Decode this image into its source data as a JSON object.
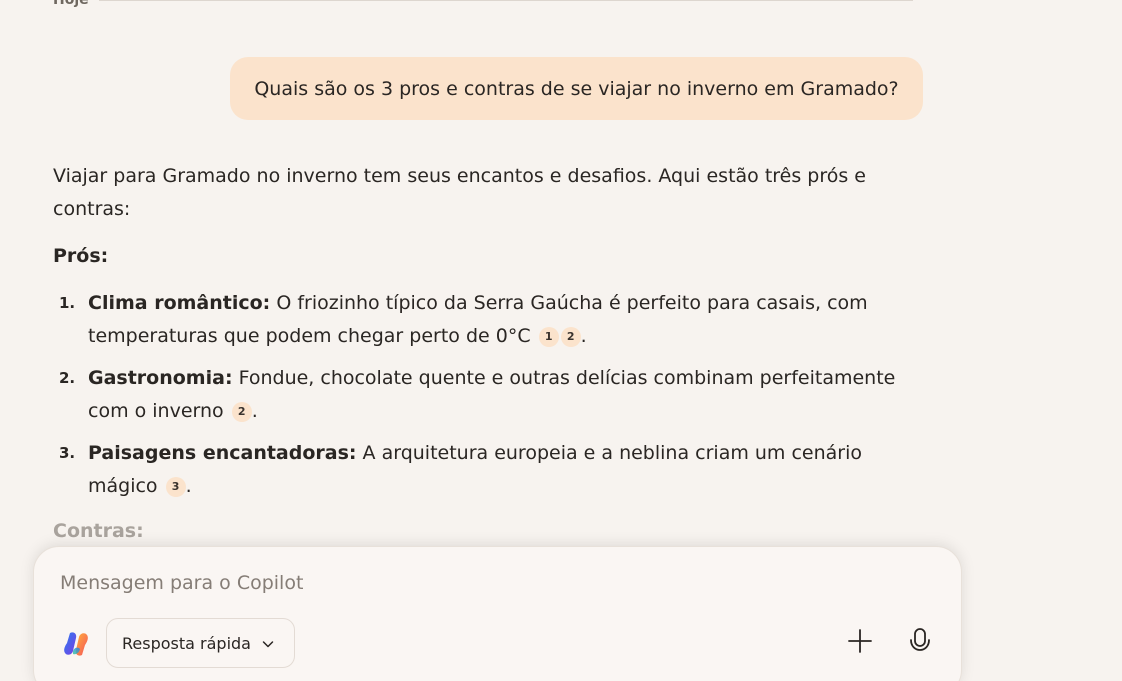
{
  "day_label": "Hoje",
  "user_message": "Quais são os 3 pros e contras de se viajar no inverno em Gramado?",
  "answer": {
    "intro": "Viajar para Gramado no inverno tem seus encantos e desafios. Aqui estão três prós e contras:",
    "pros_title": "Prós:",
    "pros": [
      {
        "num": "1.",
        "term": "Clima romântico:",
        "text": " O friozinho típico da Serra Gaúcha é perfeito para casais, com temperaturas que podem chegar perto de 0°C",
        "citations": [
          "1",
          "2"
        ]
      },
      {
        "num": "2.",
        "term": "Gastronomia:",
        "text": " Fondue, chocolate quente e outras delícias combinam perfeitamente com o inverno",
        "citations": [
          "2"
        ]
      },
      {
        "num": "3.",
        "term": "Paisagens encantadoras:",
        "text": " A arquitetura europeia e a neblina criam um cenário mágico",
        "citations": [
          "3"
        ]
      }
    ],
    "cons_title": "Contras:"
  },
  "composer": {
    "placeholder": "Mensagem para o Copilot",
    "value": "",
    "mode_label": "Resposta rápida",
    "logo_icon": "copilot-logo-icon",
    "add_icon": "plus-icon",
    "mic_icon": "microphone-icon"
  },
  "colors": {
    "background": "#f7f3ef",
    "bubble": "#fbe3cc",
    "text": "#2a2623"
  }
}
